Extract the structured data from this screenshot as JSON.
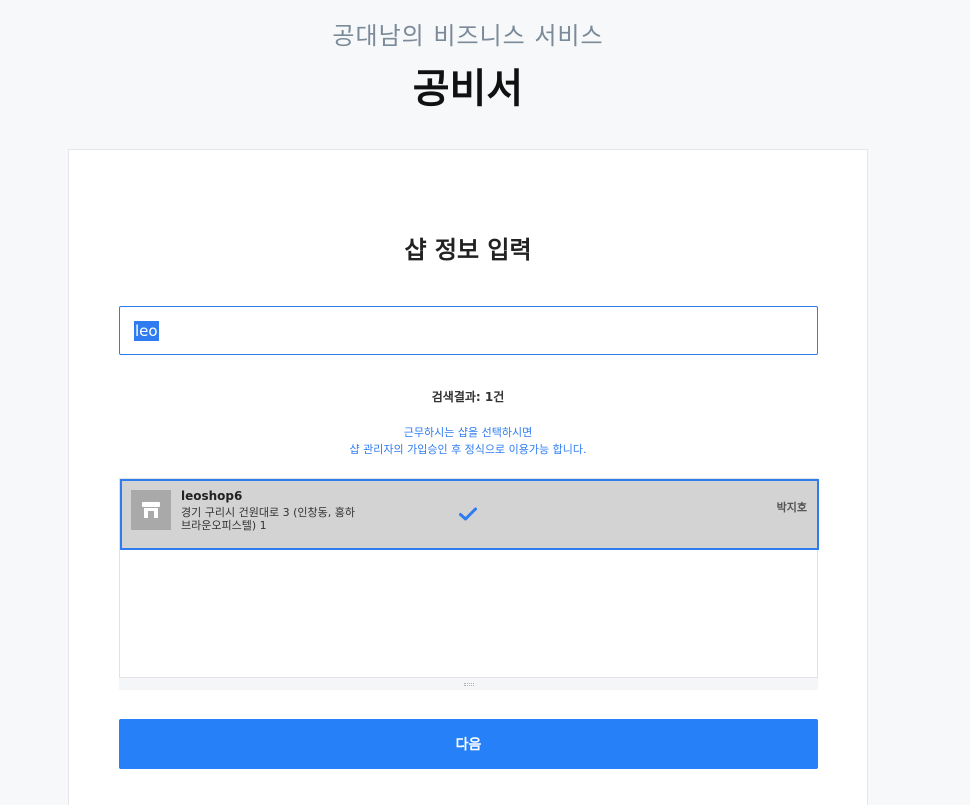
{
  "header": {
    "subtitle": "공대남의 비즈니스 서비스",
    "title": "공비서"
  },
  "form": {
    "title": "샵 정보 입력",
    "search_value": "leo",
    "result_count": "검색결과: 1건",
    "notice_line1": "근무하시는 샵을 선택하시면",
    "notice_line2": "샵 관리자의 가입승인 후 정식으로 이용가능 합니다.",
    "next_label": "다음"
  },
  "results": [
    {
      "icon": "store-icon",
      "name": "leoshop6",
      "address": "경기 구리시 건원대로 3 (인창동, 홍하브라운오피스텔) 1",
      "owner": "박지호",
      "selected": true
    }
  ],
  "colors": {
    "accent": "#2680f7",
    "selected_row_bg": "#d3d3d3",
    "notice_text": "#2f7cf0"
  }
}
